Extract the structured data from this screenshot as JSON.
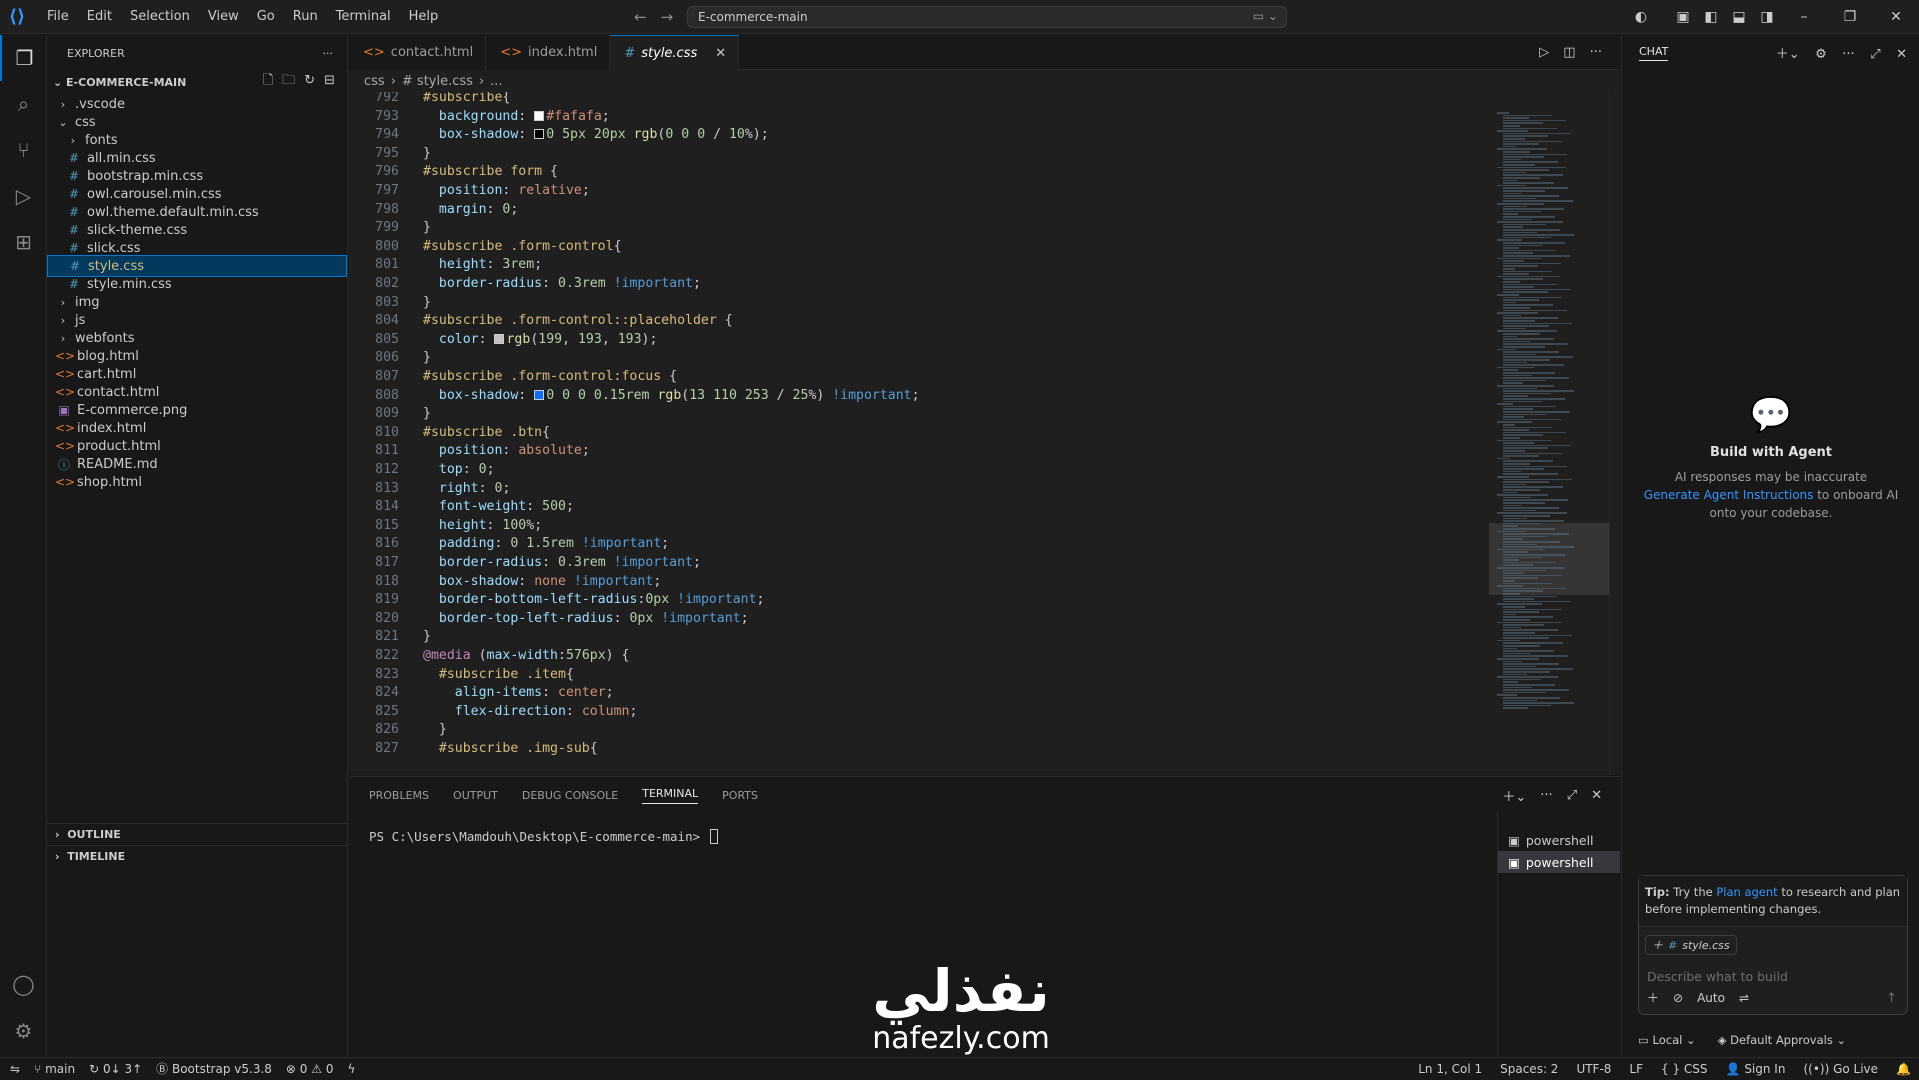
{
  "titlebar": {
    "menu": [
      "File",
      "Edit",
      "Selection",
      "View",
      "Go",
      "Run",
      "Terminal",
      "Help"
    ],
    "search_text": "E-commerce-main"
  },
  "sidebar": {
    "header": "EXPLORER",
    "folder": "E-COMMERCE-MAIN",
    "tree": [
      {
        "label": ".vscode",
        "type": "folder",
        "depth": 0,
        "open": false
      },
      {
        "label": "css",
        "type": "folder",
        "depth": 0,
        "open": true
      },
      {
        "label": "fonts",
        "type": "folder",
        "depth": 1,
        "open": false
      },
      {
        "label": "all.min.css",
        "type": "css",
        "depth": 1
      },
      {
        "label": "bootstrap.min.css",
        "type": "css",
        "depth": 1
      },
      {
        "label": "owl.carousel.min.css",
        "type": "css",
        "depth": 1
      },
      {
        "label": "owl.theme.default.min.css",
        "type": "css",
        "depth": 1
      },
      {
        "label": "slick-theme.css",
        "type": "css",
        "depth": 1
      },
      {
        "label": "slick.css",
        "type": "css",
        "depth": 1
      },
      {
        "label": "style.css",
        "type": "css",
        "depth": 1,
        "selected": true
      },
      {
        "label": "style.min.css",
        "type": "css",
        "depth": 1
      },
      {
        "label": "img",
        "type": "folder",
        "depth": 0,
        "open": false
      },
      {
        "label": "js",
        "type": "folder",
        "depth": 0,
        "open": false
      },
      {
        "label": "webfonts",
        "type": "folder",
        "depth": 0,
        "open": false
      },
      {
        "label": "blog.html",
        "type": "html",
        "depth": 0
      },
      {
        "label": "cart.html",
        "type": "html",
        "depth": 0
      },
      {
        "label": "contact.html",
        "type": "html",
        "depth": 0
      },
      {
        "label": "E-commerce.png",
        "type": "png",
        "depth": 0
      },
      {
        "label": "index.html",
        "type": "html",
        "depth": 0
      },
      {
        "label": "product.html",
        "type": "html",
        "depth": 0
      },
      {
        "label": "README.md",
        "type": "md",
        "depth": 0
      },
      {
        "label": "shop.html",
        "type": "html",
        "depth": 0
      }
    ],
    "outline": "OUTLINE",
    "timeline": "TIMELINE"
  },
  "editor": {
    "tabs": [
      {
        "label": "contact.html",
        "type": "html"
      },
      {
        "label": "index.html",
        "type": "html"
      },
      {
        "label": "style.css",
        "type": "css",
        "active": true
      }
    ],
    "breadcrumb": [
      "css",
      "# style.css",
      "..."
    ],
    "lines": [
      {
        "n": "792",
        "t": "#subscribe{"
      },
      {
        "n": "793",
        "t": "  background: #fafafa;"
      },
      {
        "n": "794",
        "t": "  box-shadow: 0 5px 20px rgb(0 0 0 / 10%);"
      },
      {
        "n": "795",
        "t": "}"
      },
      {
        "n": "796",
        "t": "#subscribe form {"
      },
      {
        "n": "797",
        "t": "  position: relative;"
      },
      {
        "n": "798",
        "t": "  margin: 0;"
      },
      {
        "n": "799",
        "t": "}"
      },
      {
        "n": "800",
        "t": "#subscribe .form-control{"
      },
      {
        "n": "801",
        "t": "  height: 3rem;"
      },
      {
        "n": "802",
        "t": "  border-radius: 0.3rem !important;"
      },
      {
        "n": "803",
        "t": "}"
      },
      {
        "n": "804",
        "t": "#subscribe .form-control::placeholder {"
      },
      {
        "n": "805",
        "t": "  color: rgb(199, 193, 193);"
      },
      {
        "n": "806",
        "t": "}"
      },
      {
        "n": "807",
        "t": "#subscribe .form-control:focus {"
      },
      {
        "n": "808",
        "t": "  box-shadow: 0 0 0 0.15rem rgb(13 110 253 / 25%) !important;"
      },
      {
        "n": "809",
        "t": "}"
      },
      {
        "n": "810",
        "t": "#subscribe .btn{"
      },
      {
        "n": "811",
        "t": "  position: absolute;"
      },
      {
        "n": "812",
        "t": "  top: 0;"
      },
      {
        "n": "813",
        "t": "  right: 0;"
      },
      {
        "n": "814",
        "t": "  font-weight: 500;"
      },
      {
        "n": "815",
        "t": "  height: 100%;"
      },
      {
        "n": "816",
        "t": "  padding: 0 1.5rem !important;"
      },
      {
        "n": "817",
        "t": "  border-radius: 0.3rem !important;"
      },
      {
        "n": "818",
        "t": "  box-shadow: none !important;"
      },
      {
        "n": "819",
        "t": "  border-bottom-left-radius:0px !important;"
      },
      {
        "n": "820",
        "t": "  border-top-left-radius: 0px !important;"
      },
      {
        "n": "821",
        "t": "}"
      },
      {
        "n": "822",
        "t": "@media (max-width:576px) {"
      },
      {
        "n": "823",
        "t": "  #subscribe .item{"
      },
      {
        "n": "824",
        "t": "    align-items: center;"
      },
      {
        "n": "825",
        "t": "    flex-direction: column;"
      },
      {
        "n": "826",
        "t": "  }"
      },
      {
        "n": "827",
        "t": "  #subscribe .img-sub{"
      }
    ],
    "swatches": {
      "793": "#fafafa",
      "794": "#000000",
      "805": "#c7c1c1",
      "808": "#0d6efd"
    }
  },
  "panel": {
    "tabs": [
      "PROBLEMS",
      "OUTPUT",
      "DEBUG CONSOLE",
      "TERMINAL",
      "PORTS"
    ],
    "active_tab": "TERMINAL",
    "prompt": "PS C:\\Users\\Mamdouh\\Desktop\\E-commerce-main> ",
    "terminals": [
      "powershell",
      "powershell"
    ]
  },
  "watermark": {
    "arabic": "نفذلي",
    "latin": "nafezly.com"
  },
  "chat": {
    "title": "CHAT",
    "agent_title": "Build with Agent",
    "agent_text_1": "AI responses may be inaccurate",
    "agent_link": "Generate Agent Instructions",
    "agent_text_2": " to onboard AI onto your codebase.",
    "tip_label": "Tip:",
    "tip_pre": " Try the ",
    "tip_link": "Plan agent",
    "tip_post": " to research and plan before implementing changes.",
    "context_file": "style.css",
    "input_placeholder": "Describe what to build",
    "mode": "Auto",
    "location": "Local",
    "approvals": "Default Approvals"
  },
  "statusbar": {
    "branch": "main",
    "sync": "0↓ 3↑",
    "bootstrap": "Bootstrap v5.3.8",
    "errors": "0",
    "warnings": "0",
    "cursor": "Ln 1, Col 1",
    "spaces": "Spaces: 2",
    "encoding": "UTF-8",
    "eol": "LF",
    "language": "CSS",
    "signin": "Sign In",
    "golive": "Go Live"
  }
}
